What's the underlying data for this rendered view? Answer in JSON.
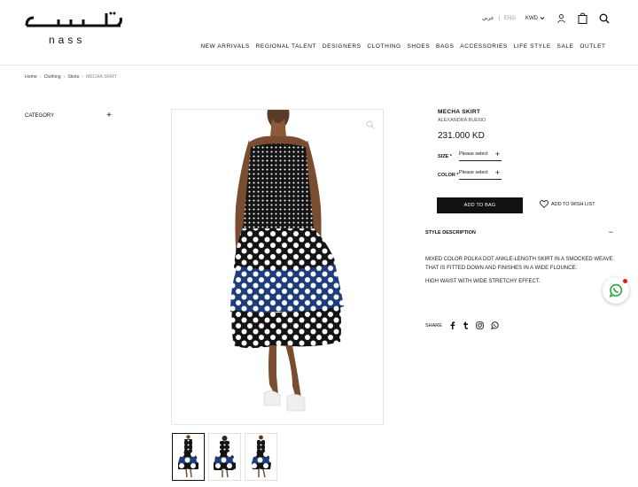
{
  "brand": {
    "arabic": "ناس",
    "latin": "nass"
  },
  "header_utils": {
    "arabic_lang": "عربي",
    "english_lang": "ENG",
    "currency": "KWD"
  },
  "nav": [
    "NEW ARRIVALS",
    "REGIONAL TALENT",
    "DESIGNERS",
    "CLOTHING",
    "SHOES",
    "BAGS",
    "ACCESSORIES",
    "LIFE STYLE",
    "SALE",
    "OUTLET"
  ],
  "breadcrumb": [
    "Home",
    "Clothing",
    "Skirts",
    "MECHA SKIRT"
  ],
  "sidebar": {
    "category_label": "CATEGORY"
  },
  "product": {
    "name": "MECHA SKIRT",
    "designer": "ALEXANDRA BUENO",
    "price": "231.000 KD",
    "size_label": "SIZE",
    "size_value": "Please select",
    "color_label": "COLOR",
    "color_value": "Please select",
    "add_to_bag": "ADD TO BAG",
    "wishlist": "ADD TO WISH LIST",
    "style_description_title": "STYLE DESCRIPTION",
    "description": [
      "MIXED COLOR POLKA DOT ANKLE-LENGTH SKIRT IN A SMOCKED WEAVE THAT IS FITTED DOWN AND FINISHES IN A WIDE FLOUNCE.",
      "HIGH WAIST WITH WIDE STRETCHY EFFECT."
    ],
    "share_label": "SHARE"
  },
  "colors": {
    "accent": "#111111",
    "navy_polka": "#1f3d7a",
    "notification": "#e21b1b"
  }
}
